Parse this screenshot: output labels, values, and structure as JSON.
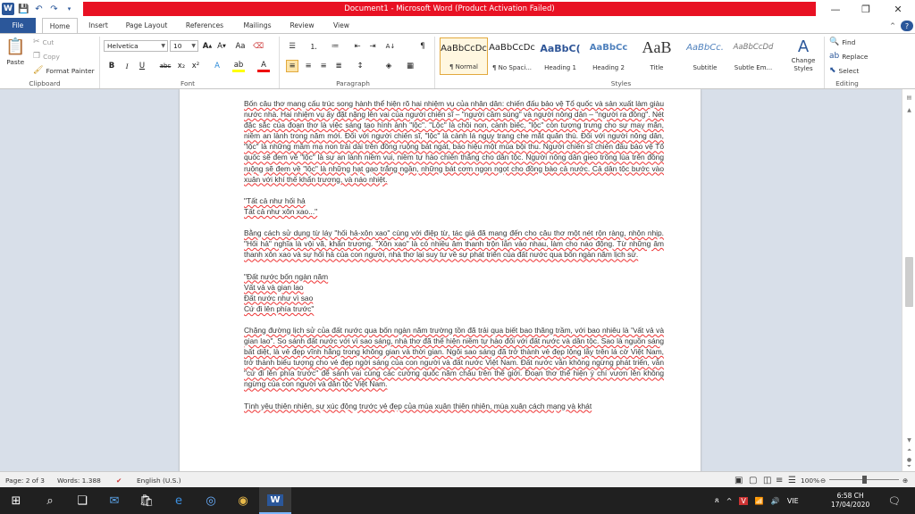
{
  "title_bar": {
    "app_icon": "W",
    "title": "Document1  -  Microsoft Word (Product Activation Failed)",
    "controls": [
      "minimize-icon",
      "restore-icon",
      "close-icon"
    ]
  },
  "tabs": [
    "File",
    "Home",
    "Insert",
    "Page Layout",
    "References",
    "Mailings",
    "Review",
    "View"
  ],
  "active_tab": "Home",
  "ribbon": {
    "clipboard": {
      "paste": "Paste",
      "cut": "Cut",
      "copy": "Copy",
      "format_painter": "Format Painter",
      "label": "Clipboard"
    },
    "font": {
      "name": "Helvetica",
      "size": "10",
      "label": "Font",
      "bold": "B",
      "italic": "I",
      "underline": "U",
      "strike": "abc",
      "subscript": "x₂",
      "superscript": "x²"
    },
    "paragraph": {
      "label": "Paragraph"
    },
    "styles": {
      "label": "Styles",
      "items": [
        {
          "sample": "AaBbCcDc",
          "name": "¶ Normal"
        },
        {
          "sample": "AaBbCcDc",
          "name": "¶ No Spaci..."
        },
        {
          "sample": "AaBbC(",
          "name": "Heading 1"
        },
        {
          "sample": "AaBbCc",
          "name": "Heading 2"
        },
        {
          "sample": "AaB",
          "name": "Title"
        },
        {
          "sample": "AaBbCc.",
          "name": "Subtitle"
        },
        {
          "sample": "AaBbCcDd",
          "name": "Subtle Em..."
        }
      ],
      "change_styles": "Change Styles"
    },
    "editing": {
      "find": "Find",
      "replace": "Replace",
      "select": "Select",
      "label": "Editing"
    }
  },
  "document": {
    "paragraphs": [
      {
        "type": "p",
        "text": "Bốn câu thơ mang cấu trúc song hành thể hiện rõ hai nhiệm vụ của nhân dân: chiến đấu bảo vệ Tổ quốc và sản xuất làm giàu nước nhà. Hai nhiệm vụ ấy đặt nặng lên vai của người chiến sĩ – \"người cầm súng\" và người nông dân – \"người ra đồng\". Nét đặc sắc của đoạn thơ là việc sáng tạo hình ảnh \"lộc\". \"Lộc\" là chồi non, cành biếc, \"lộc\" còn tượng trưng cho sự may mắn, niềm an lành trong năm mới. Đối với người chiến sĩ, \"lộc\" là cành lá ngụy trang che mắt quân thù. Đối với người nông dân, \"lộc\" là những mầm mạ non trải dài trên đồng ruộng bát ngát, báo hiệu một mùa bội thu. Người chiến sĩ chiến đấu bảo vệ Tổ quốc sẽ đem về \"lộc\" là sự an lành niềm vui, niềm tự hào chiến thắng cho dân tộc. Người nông dân gieo trồng lúa trên đồng ruộng sẽ đem về \"lộc\" là những hạt gạo trắng ngần, những bát cơm ngon ngọt cho đồng bào cả nước. Cả dân tộc bước vào xuân với khí thế khẩn trương, và náo nhiệt."
      },
      {
        "type": "v",
        "text": "\"Tất cả như hối hả"
      },
      {
        "type": "vlast",
        "text": "Tất cả như xôn xao...\""
      },
      {
        "type": "p",
        "text": "Bằng cách sử dụng từ láy \"hối hả-xôn xao\" cùng với điệp từ, tác giả đã mang đến cho câu thơ một nét rộn ràng, nhộn nhịp. \"Hối hả\" nghĩa là vội vã, khẩn trương. \"Xôn xao\" là có nhiều âm thanh trộn lẫn vào nhau, làm cho náo động. Từ những âm thanh xôn xao và sự hối hả của con người, nhà thơ lại suy tư về sự phát triển của đất nước qua bốn ngàn năm lịch sử."
      },
      {
        "type": "v",
        "text": "\"Đất nước bốn ngàn năm"
      },
      {
        "type": "v",
        "text": "Vất vả và gian lao"
      },
      {
        "type": "v",
        "text": "Đất nước như vì sao"
      },
      {
        "type": "vlast",
        "text": "Cứ đi lên phía trước\""
      },
      {
        "type": "p",
        "text": "Chặng đường lịch sử của đất nước qua bốn ngàn năm trường tồn đã trải qua biết bao thăng trầm, với bao nhiêu là \"vất vả và gian lao\". So sánh đất nước với vì sao sáng, nhà thơ đã thể hiện niềm tự hào đối với đất nước và dân tộc. Sao là nguồn sáng bất diệt, là vẻ đẹp vĩnh hằng trong không gian và thời gian. Ngôi sao sáng đã trở thành vẻ đẹp lộng lẫy trên lá cờ Việt Nam, trở thành biểu tượng cho vẻ đẹp ngời sáng của con người và đất nước Việt Nam. Đất nước vẫn không ngừng phát triển, vẫn \"cứ đi lên phía trước\" để sánh vai cùng các cường quốc năm châu trên thế giới. Đoạn thơ thể hiện ý chí vươn lên không ngừng của con người và dân tộc Việt Nam."
      },
      {
        "type": "p",
        "text": "Tình yêu thiên nhiên, sự xúc động trước vẻ đẹp của mùa xuân thiên nhiên, mùa xuân cách mạng và khát"
      }
    ]
  },
  "status_bar": {
    "page": "Page: 2 of 3",
    "words": "Words: 1.388",
    "language": "English (U.S.)",
    "zoom": "100%",
    "zoom_level": 1.0
  },
  "taskbar": {
    "language": "VIE",
    "time": "6:58 CH",
    "date": "17/04/2020"
  },
  "colors": {
    "word_blue": "#2b579a",
    "activation_red": "#e81123",
    "taskbar": "#202020"
  }
}
